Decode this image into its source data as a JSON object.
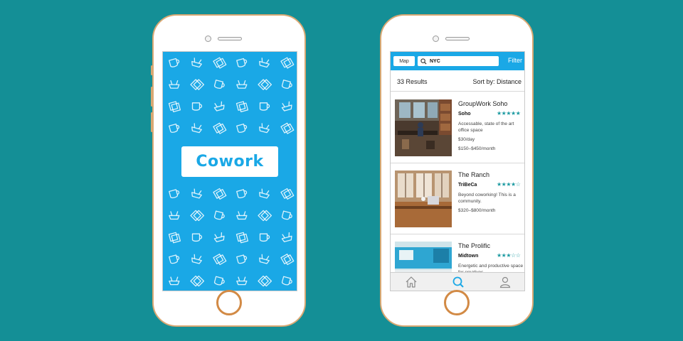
{
  "colors": {
    "background": "#148f96",
    "accent_blue": "#1aa8e6",
    "phone_gold": "#d9a873",
    "star_teal": "#1c9aa1"
  },
  "splash": {
    "logo_text": "Cowork"
  },
  "search_screen": {
    "map_button": "Map",
    "search_value": "NYC",
    "search_icon": "magnifier-icon",
    "filter_label": "Filter",
    "results_count": "33 Results",
    "sort_label": "Sort by: Distance",
    "listings": [
      {
        "name": "GroupWork Soho",
        "neighborhood": "Soho",
        "stars": "★★★★★",
        "rating": 5,
        "description": "Accessable, state of the art office space",
        "price_day": "$30/day",
        "price_month": "$150–$450/month"
      },
      {
        "name": "The Ranch",
        "neighborhood": "TriBeCa",
        "stars": "★★★★☆",
        "rating": 4,
        "description": "Beyond coworking! This is a community.",
        "price_month": "$320–$800/month"
      },
      {
        "name": "The Prolific",
        "neighborhood": "Midtown",
        "stars": "★★★☆☆",
        "rating": 3,
        "description": "Energetic and productive space for creatives."
      }
    ],
    "tabs": {
      "home_icon": "home-icon",
      "search_icon": "search-icon",
      "profile_icon": "user-icon"
    }
  }
}
